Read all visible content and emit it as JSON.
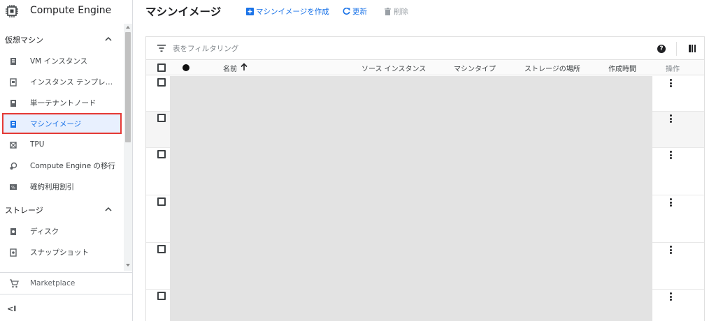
{
  "product": {
    "title": "Compute Engine",
    "icon": "chip-icon"
  },
  "nav": {
    "sections": [
      {
        "label": "仮想マシン",
        "items": [
          {
            "label": "VM インスタンス",
            "icon": "vm-instance-icon"
          },
          {
            "label": "インスタンス テンプレー...",
            "icon": "instance-template-icon"
          },
          {
            "label": "単一テナントノード",
            "icon": "sole-tenant-icon"
          },
          {
            "label": "マシンイメージ",
            "icon": "machine-image-icon",
            "active": true
          },
          {
            "label": "TPU",
            "icon": "tpu-icon"
          },
          {
            "label": "Compute Engine の移行",
            "icon": "migrate-icon"
          },
          {
            "label": "確約利用割引",
            "icon": "discount-icon"
          }
        ]
      },
      {
        "label": "ストレージ",
        "items": [
          {
            "label": "ディスク",
            "icon": "disk-icon"
          },
          {
            "label": "スナップショット",
            "icon": "snapshot-icon"
          }
        ]
      }
    ],
    "marketplace": "Marketplace",
    "collapse_label": "<I"
  },
  "header": {
    "title": "マシンイメージ",
    "actions": {
      "create": "マシンイメージを作成",
      "refresh": "更新",
      "delete": "削除"
    }
  },
  "table": {
    "filter_placeholder": "表をフィルタリング",
    "columns": {
      "name": "名前",
      "source": "ソース インスタンス",
      "machine_type": "マシンタイプ",
      "location": "ストレージの場所",
      "created": "作成時間",
      "actions": "操作"
    },
    "sort": {
      "column": "name",
      "direction": "ascending"
    },
    "row_count": 6
  },
  "colors": {
    "accent": "#1a73e8",
    "active_outline": "#e53935",
    "active_bg": "#e8f0fe",
    "redaction": "#e3e3e3"
  }
}
